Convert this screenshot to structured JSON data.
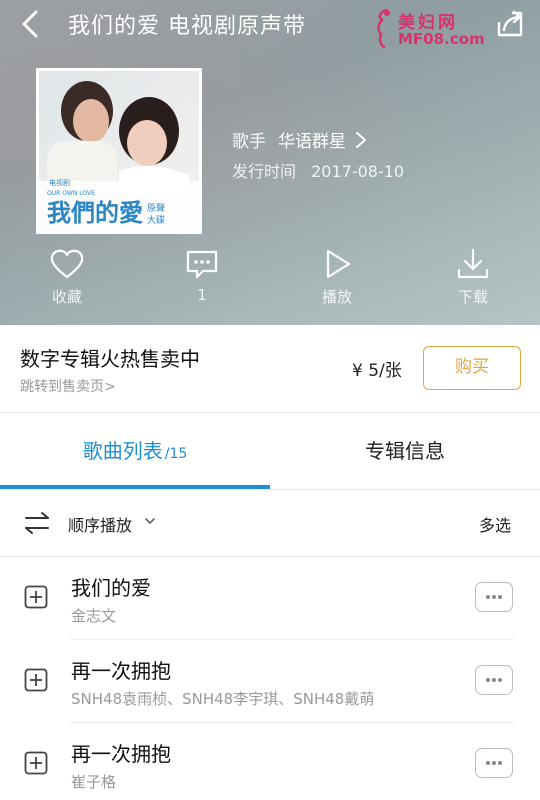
{
  "header": {
    "title": "我们的爱 电视剧原声带",
    "watermark_top": "美妇网",
    "watermark_bottom": "MF08.com",
    "icons": [
      "back-arrow-icon",
      "share-icon"
    ]
  },
  "album": {
    "cover_text_small": "电视剧",
    "cover_text_en": "OUR OWN LOVE",
    "cover_text_main": "我們的愛",
    "cover_text_sub1": "原聲",
    "cover_text_sub2": "大碟",
    "artist_label": "歌手",
    "artist_name": "华语群星",
    "release_label": "发行时间",
    "release_date": "2017-08-10"
  },
  "actions": [
    {
      "label": "收藏",
      "icon": "heart-icon"
    },
    {
      "label": "1",
      "icon": "comment-icon"
    },
    {
      "label": "播放",
      "icon": "play-icon"
    },
    {
      "label": "下载",
      "icon": "download-icon"
    }
  ],
  "purchase": {
    "title": "数字专辑火热售卖中",
    "link": "跳转到售卖页>",
    "price": "¥ 5/张",
    "button": "购买",
    "accent_color": "#e0a640"
  },
  "tabs": {
    "songs_label": "歌曲列表",
    "songs_count": "/15",
    "info_label": "专辑信息",
    "active_color": "#1e8fd4"
  },
  "toolbar": {
    "mode_label": "顺序播放",
    "multi_select": "多选"
  },
  "songs": [
    {
      "title": "我们的爱",
      "artist": "金志文"
    },
    {
      "title": "再一次拥抱",
      "artist": "SNH48袁雨桢、SNH48李宇琪、SNH48戴萌"
    },
    {
      "title": "再一次拥抱",
      "artist": "崔子格"
    }
  ]
}
